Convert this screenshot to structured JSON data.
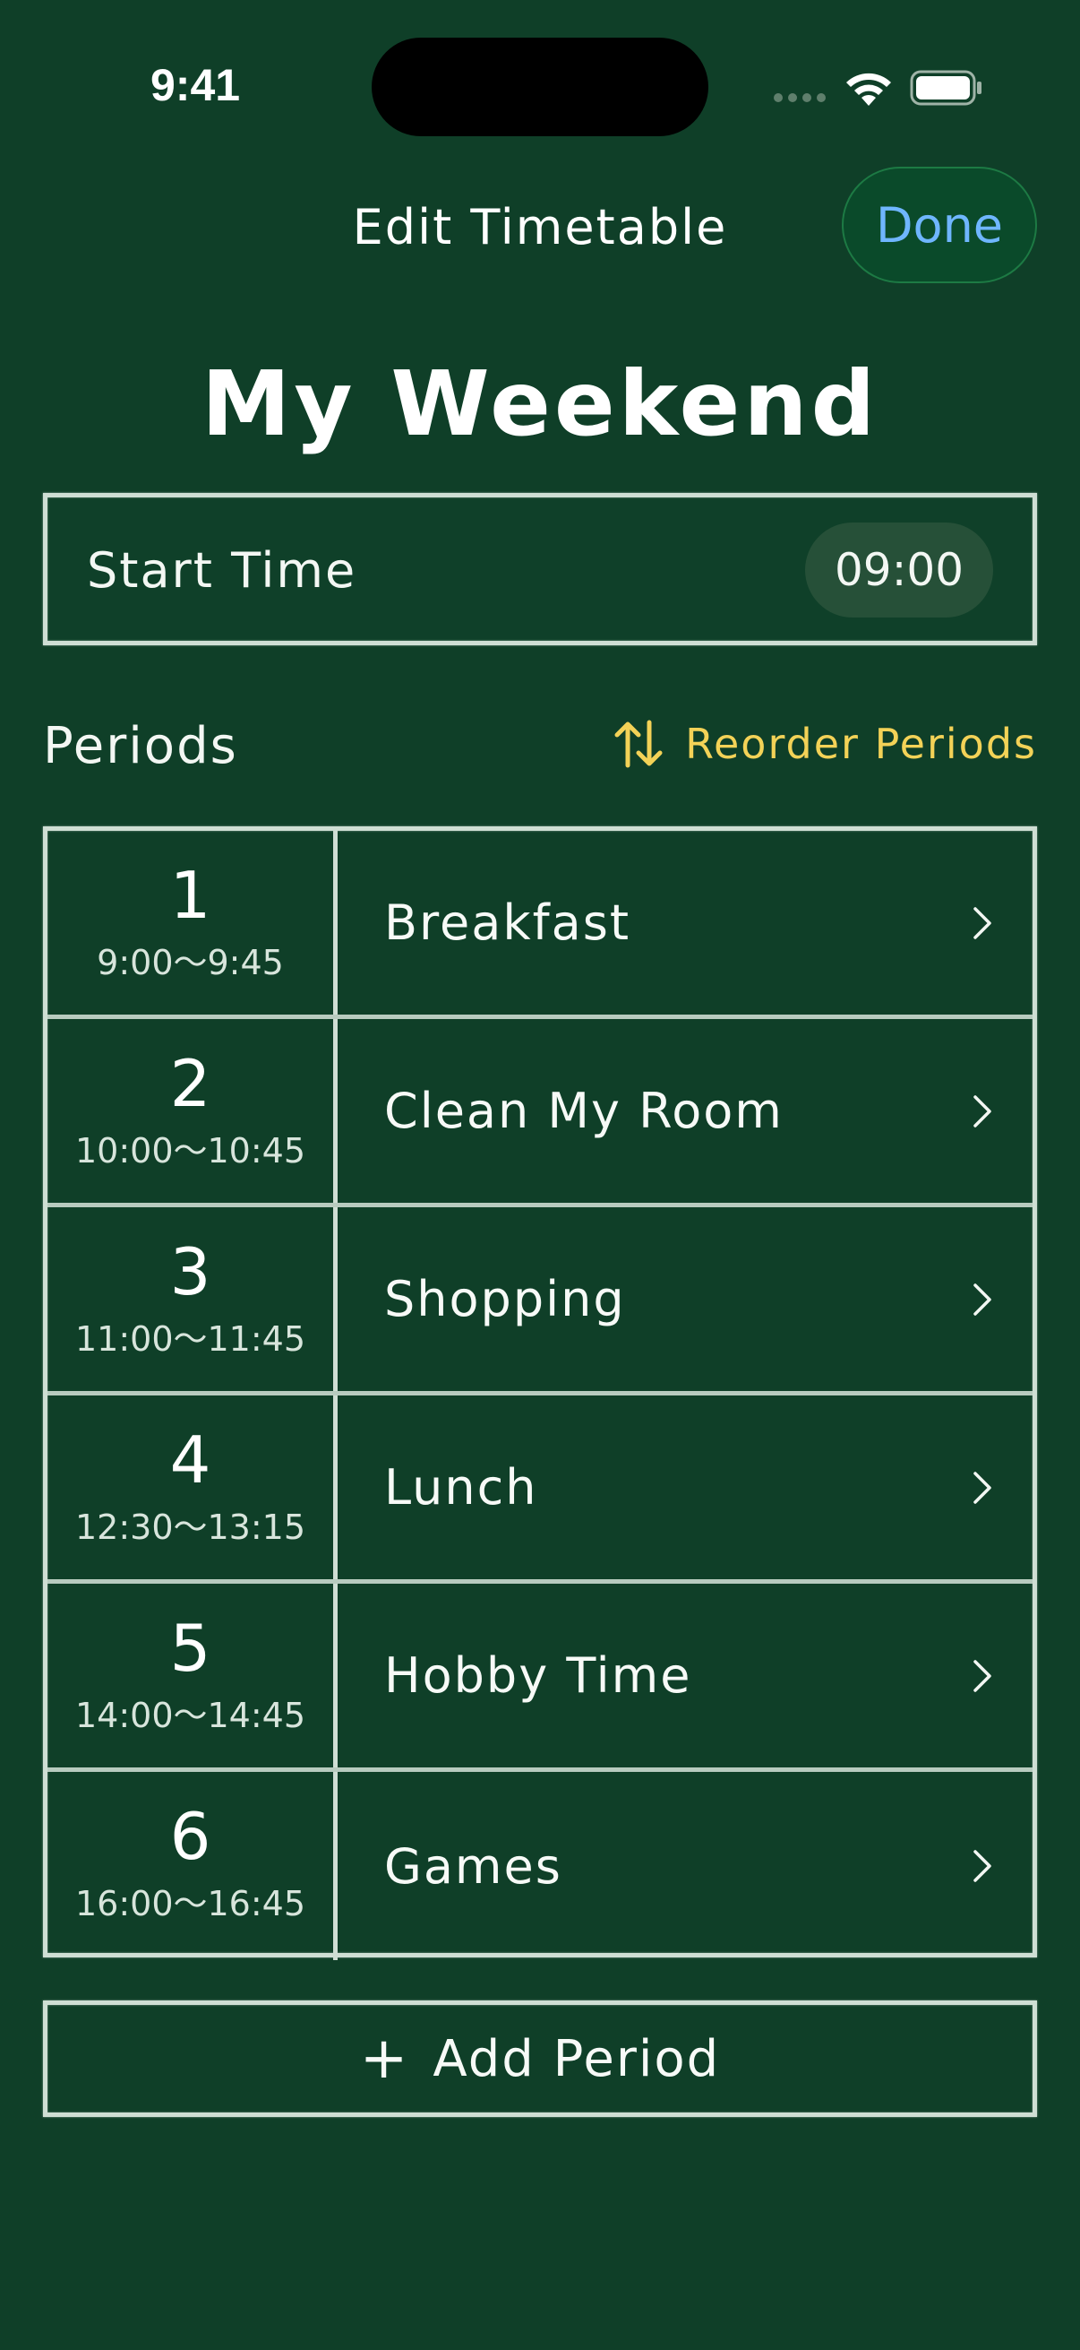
{
  "status_bar": {
    "time": "9:41"
  },
  "nav": {
    "title": "Edit Timetable",
    "done_label": "Done"
  },
  "page_title": "My Weekend",
  "start_time": {
    "label": "Start Time",
    "value": "09:00"
  },
  "periods_section": {
    "header": "Periods",
    "reorder_label": "Reorder Periods"
  },
  "periods": [
    {
      "number": "1",
      "time": "9:00〜9:45",
      "name": "Breakfast"
    },
    {
      "number": "2",
      "time": "10:00〜10:45",
      "name": "Clean My Room"
    },
    {
      "number": "3",
      "time": "11:00〜11:45",
      "name": "Shopping"
    },
    {
      "number": "4",
      "time": "12:30〜13:15",
      "name": "Lunch"
    },
    {
      "number": "5",
      "time": "14:00〜14:45",
      "name": "Hobby Time"
    },
    {
      "number": "6",
      "time": "16:00〜16:45",
      "name": "Games"
    }
  ],
  "add_period": {
    "icon": "+",
    "label": "Add Period"
  },
  "colors": {
    "background": "#0f3f28",
    "accent_yellow": "#f3d257",
    "done_blue": "#6fb6ff",
    "chalk": "#cfded4"
  }
}
